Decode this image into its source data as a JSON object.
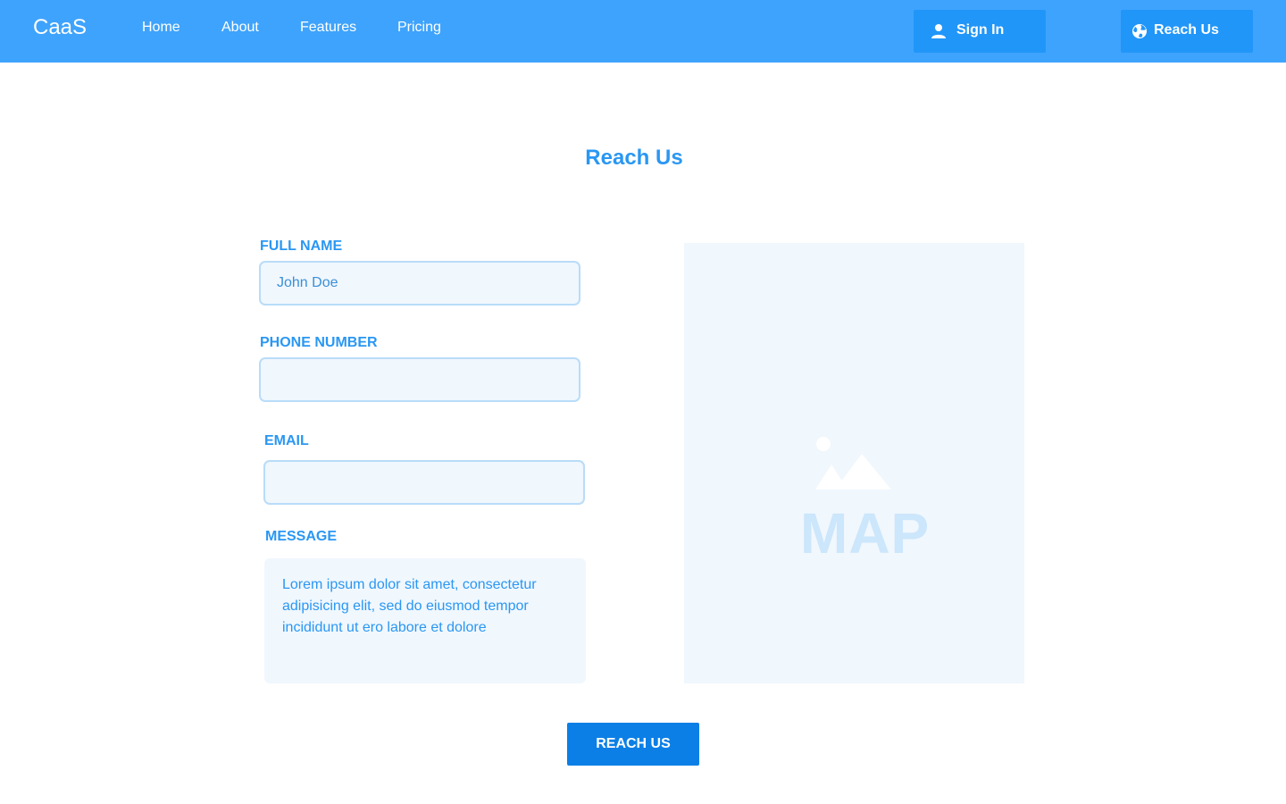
{
  "app": {
    "brand": "CaaS"
  },
  "nav": {
    "links": [
      "Home",
      "About",
      "Features",
      "Pricing"
    ],
    "sign_in_label": "Sign In",
    "reach_us_label": "Reach Us"
  },
  "page": {
    "title": "Reach Us"
  },
  "form": {
    "full_name": {
      "label": "FULL NAME",
      "value": "John Doe"
    },
    "phone": {
      "label": "PHONE NUMBER",
      "value": ""
    },
    "email": {
      "label": "EMAIL",
      "value": ""
    },
    "message": {
      "label": "MESSAGE",
      "value": "Lorem ipsum dolor sit amet, consectetur adipisicing elit, sed do eiusmod tempor incididunt ut ero labore et dolore"
    },
    "submit_label": "REACH US"
  },
  "map": {
    "label": "MAP",
    "icon": "image-placeholder-icon"
  },
  "icons": {
    "sign_in": "user-icon",
    "reach_us": "globe-icon"
  },
  "colors": {
    "navbar": "#3ea3fc",
    "nav_button": "#2196f9",
    "accent": "#2a97f3",
    "input_bg": "#f0f7fd",
    "input_border": "#b9dcf8",
    "submit": "#0b7fe6"
  }
}
